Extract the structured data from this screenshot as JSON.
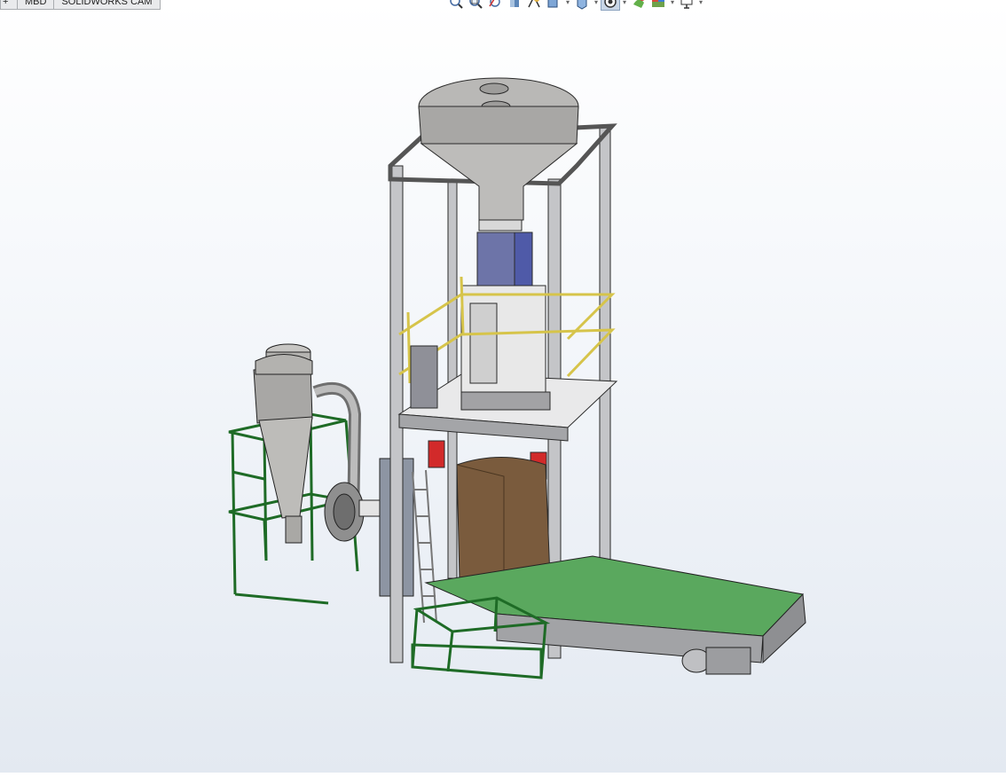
{
  "tabs": [
    {
      "label": "+",
      "id": "first"
    },
    {
      "label": "MBD",
      "id": "mbd"
    },
    {
      "label": "SOLIDWORKS CAM",
      "id": "cam"
    }
  ],
  "toolbar": [
    {
      "name": "zoom-to-fit-icon"
    },
    {
      "name": "zoom-to-area-icon"
    },
    {
      "name": "previous-view-icon"
    },
    {
      "name": "section-view-icon"
    },
    {
      "name": "dynamic-annotation-icon"
    },
    {
      "name": "view-orientation-icon",
      "dropdown": true
    },
    {
      "name": "display-style-icon",
      "dropdown": true
    },
    {
      "name": "hide-show-items-icon",
      "dropdown": true,
      "active": true
    },
    {
      "name": "edit-appearance-icon"
    },
    {
      "name": "apply-scene-icon",
      "dropdown": true
    },
    {
      "name": "view-settings-icon",
      "dropdown": true
    }
  ],
  "colors": {
    "frame": "#9c9ea2",
    "green_frame": "#1e6b26",
    "belt": "#5aa85e",
    "bag": "#7a5b3d",
    "yellow_rail": "#d6c44a",
    "blue_box": "#3e4ea8",
    "red_clamp": "#d22a2a"
  }
}
